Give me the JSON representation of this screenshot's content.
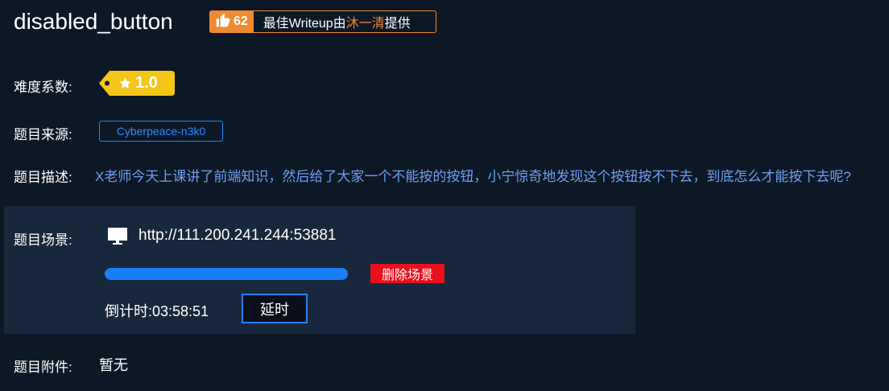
{
  "challenge": {
    "title": "disabled_button"
  },
  "writeup_badge": {
    "likes": "62",
    "text_prefix": "最佳Writeup由",
    "author": "沐一清",
    "text_suffix": "提供",
    "icon": "thumbs-up-icon"
  },
  "difficulty": {
    "label": "难度系数:",
    "value": "1.0",
    "icon": "star-icon"
  },
  "source": {
    "label": "题目来源:",
    "value": "Cyberpeace-n3k0"
  },
  "description": {
    "label": "题目描述:",
    "text": "X老师今天上课讲了前端知识，然后给了大家一个不能按的按钮，小宁惊奇地发现这个按钮按不下去，到底怎么才能按下去呢?"
  },
  "scene": {
    "label": "题目场景:",
    "icon": "monitor-icon",
    "url": "http://111.200.241.244:53881",
    "progress": 1.0,
    "delete_label": "删除场景",
    "countdown_label": "倒计时:",
    "countdown_value": "03:58:51",
    "extend_label": "延时"
  },
  "attachment": {
    "label": "题目附件:",
    "value": "暂无"
  },
  "colors": {
    "background": "#0d1827",
    "panel": "#17283c",
    "accent_orange": "#f08a32",
    "accent_blue": "#1e82ff",
    "danger": "#e8111c",
    "difficulty_yellow": "#f5c518"
  }
}
